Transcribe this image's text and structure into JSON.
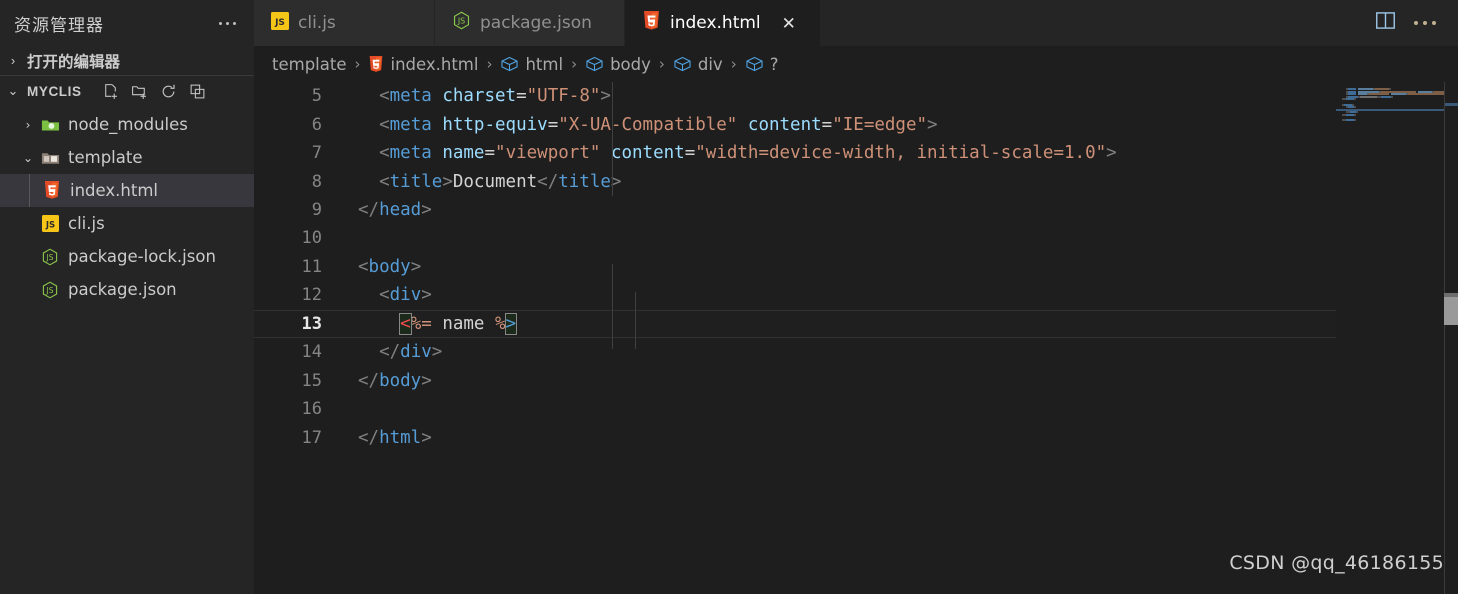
{
  "sidebar": {
    "title": "资源管理器",
    "more_label": "···",
    "open_editors": {
      "label": "打开的编辑器",
      "chevron": "›"
    },
    "project": {
      "label": "MYCLIS",
      "chevron": "⌄",
      "actions": [
        {
          "name": "new-file",
          "tooltip": "新建文件"
        },
        {
          "name": "new-folder",
          "tooltip": "新建文件夹"
        },
        {
          "name": "refresh",
          "tooltip": "刷新资源管理器"
        },
        {
          "name": "collapse-all",
          "tooltip": "在资源管理器中折叠文件夹"
        }
      ]
    },
    "tree": [
      {
        "label": "node_modules",
        "type": "folder",
        "expanded": false,
        "chevron": "›",
        "depth": 1,
        "selected": false
      },
      {
        "label": "template",
        "type": "folder-open",
        "expanded": true,
        "chevron": "⌄",
        "depth": 1,
        "selected": false
      },
      {
        "label": "index.html",
        "type": "html",
        "chevron": "",
        "depth": 2,
        "selected": true
      },
      {
        "label": "cli.js",
        "type": "js",
        "chevron": "",
        "depth": 1,
        "selected": false
      },
      {
        "label": "package-lock.json",
        "type": "nodejs",
        "chevron": "",
        "depth": 1,
        "selected": false
      },
      {
        "label": "package.json",
        "type": "nodejs",
        "chevron": "",
        "depth": 1,
        "selected": false
      }
    ]
  },
  "tabs": [
    {
      "label": "cli.js",
      "icon": "js",
      "active": false,
      "closable": false
    },
    {
      "label": "package.json",
      "icon": "nodejs",
      "active": false,
      "closable": false
    },
    {
      "label": "index.html",
      "icon": "html",
      "active": true,
      "closable": true,
      "close_glyph": "✕"
    }
  ],
  "tabbar_actions": [
    {
      "name": "split-editor",
      "label": "拆分编辑器"
    },
    {
      "name": "more-actions",
      "label": "···"
    }
  ],
  "breadcrumb": [
    {
      "label": "template",
      "icon": "none"
    },
    {
      "label": "index.html",
      "icon": "html"
    },
    {
      "label": "html",
      "icon": "symbol-field"
    },
    {
      "label": "body",
      "icon": "symbol-field"
    },
    {
      "label": "div",
      "icon": "symbol-field"
    },
    {
      "label": "?",
      "icon": "symbol-field"
    }
  ],
  "breadcrumb_separator": "›",
  "editor": {
    "active_line": 13,
    "first_line": 5,
    "lines": [
      {
        "n": 5,
        "tokens": [
          {
            "t": "  ",
            "c": "plain"
          },
          {
            "t": "<",
            "c": "delim"
          },
          {
            "t": "meta",
            "c": "tag"
          },
          {
            "t": " ",
            "c": "plain"
          },
          {
            "t": "charset",
            "c": "attr"
          },
          {
            "t": "=",
            "c": "eq"
          },
          {
            "t": "\"UTF-8\"",
            "c": "str"
          },
          {
            "t": ">",
            "c": "delim"
          }
        ]
      },
      {
        "n": 6,
        "tokens": [
          {
            "t": "  ",
            "c": "plain"
          },
          {
            "t": "<",
            "c": "delim"
          },
          {
            "t": "meta",
            "c": "tag"
          },
          {
            "t": " ",
            "c": "plain"
          },
          {
            "t": "http-equiv",
            "c": "attr"
          },
          {
            "t": "=",
            "c": "eq"
          },
          {
            "t": "\"X-UA-Compatible\"",
            "c": "str"
          },
          {
            "t": " ",
            "c": "plain"
          },
          {
            "t": "content",
            "c": "attr"
          },
          {
            "t": "=",
            "c": "eq"
          },
          {
            "t": "\"IE=edge\"",
            "c": "str"
          },
          {
            "t": ">",
            "c": "delim"
          }
        ]
      },
      {
        "n": 7,
        "tokens": [
          {
            "t": "  ",
            "c": "plain"
          },
          {
            "t": "<",
            "c": "delim"
          },
          {
            "t": "meta",
            "c": "tag"
          },
          {
            "t": " ",
            "c": "plain"
          },
          {
            "t": "name",
            "c": "attr"
          },
          {
            "t": "=",
            "c": "eq"
          },
          {
            "t": "\"viewport\"",
            "c": "str"
          },
          {
            "t": " ",
            "c": "plain"
          },
          {
            "t": "content",
            "c": "attr"
          },
          {
            "t": "=",
            "c": "eq"
          },
          {
            "t": "\"width=device-width, initial-scale=1.0\"",
            "c": "str"
          },
          {
            "t": ">",
            "c": "delim"
          }
        ]
      },
      {
        "n": 8,
        "tokens": [
          {
            "t": "  ",
            "c": "plain"
          },
          {
            "t": "<",
            "c": "delim"
          },
          {
            "t": "title",
            "c": "tag"
          },
          {
            "t": ">",
            "c": "delim"
          },
          {
            "t": "Document",
            "c": "plain"
          },
          {
            "t": "</",
            "c": "delim"
          },
          {
            "t": "title",
            "c": "tag"
          },
          {
            "t": ">",
            "c": "delim"
          }
        ]
      },
      {
        "n": 9,
        "tokens": [
          {
            "t": "</",
            "c": "delim"
          },
          {
            "t": "head",
            "c": "tag"
          },
          {
            "t": ">",
            "c": "delim"
          }
        ]
      },
      {
        "n": 10,
        "tokens": []
      },
      {
        "n": 11,
        "tokens": [
          {
            "t": "<",
            "c": "delim"
          },
          {
            "t": "body",
            "c": "tag"
          },
          {
            "t": ">",
            "c": "delim"
          }
        ]
      },
      {
        "n": 12,
        "tokens": [
          {
            "t": "  ",
            "c": "plain"
          },
          {
            "t": "<",
            "c": "delim"
          },
          {
            "t": "div",
            "c": "tag"
          },
          {
            "t": ">",
            "c": "delim"
          }
        ]
      },
      {
        "n": 13,
        "tokens": [
          {
            "t": "    ",
            "c": "plain"
          },
          {
            "t": "<",
            "c": "err",
            "box": true
          },
          {
            "t": "%=",
            "c": "str"
          },
          {
            "t": " name ",
            "c": "plain"
          },
          {
            "t": "%",
            "c": "str"
          },
          {
            "t": ">",
            "c": "tag",
            "box": true
          }
        ]
      },
      {
        "n": 14,
        "tokens": [
          {
            "t": "  ",
            "c": "plain"
          },
          {
            "t": "</",
            "c": "delim"
          },
          {
            "t": "div",
            "c": "tag"
          },
          {
            "t": ">",
            "c": "delim"
          }
        ]
      },
      {
        "n": 15,
        "tokens": [
          {
            "t": "</",
            "c": "delim"
          },
          {
            "t": "body",
            "c": "tag"
          },
          {
            "t": ">",
            "c": "delim"
          }
        ]
      },
      {
        "n": 16,
        "tokens": []
      },
      {
        "n": 17,
        "tokens": [
          {
            "t": "</",
            "c": "delim"
          },
          {
            "t": "html",
            "c": "tag"
          },
          {
            "t": ">",
            "c": "delim"
          }
        ]
      }
    ]
  },
  "watermark": "CSDN @qq_46186155",
  "colors": {
    "bg_editor": "#1e1e1e",
    "bg_sidebar": "#252526",
    "bg_tab_inactive": "#2d2d2d",
    "tag": "#569cd6",
    "attr": "#9cdcfe",
    "string": "#ce9178",
    "plain": "#d4d4d4",
    "error": "#f14c4c",
    "selection": "#37373d",
    "html_icon": "#e34c26",
    "js_icon": "#f1c40f",
    "node_icon": "#8cc84b"
  }
}
